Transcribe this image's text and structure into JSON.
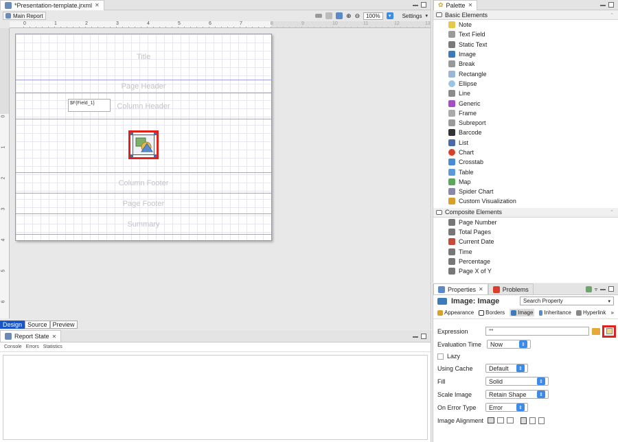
{
  "editor": {
    "tab_title": "*Presentation-template.jrxml",
    "tab_close": "✕",
    "main_report_label": "Main Report",
    "zoom_value": "100%",
    "settings_label": "Settings",
    "ruler_h_numbers": [
      "0",
      "1",
      "2",
      "3",
      "4",
      "5",
      "6",
      "7",
      "8",
      "9",
      "10",
      "11",
      "12",
      "13"
    ],
    "ruler_v_numbers": [
      "0",
      "1",
      "2",
      "3",
      "4",
      "5",
      "6"
    ],
    "bands": [
      "Title",
      "Page Header",
      "Column Header",
      "",
      "Column Footer",
      "Page Footer",
      "Summary"
    ],
    "field_label": "$F{Field_1}",
    "bottom_tabs": [
      "Design",
      "Source",
      "Preview"
    ]
  },
  "report_state": {
    "title": "Report State",
    "close": "✕",
    "subtabs": [
      "Console",
      "Errors",
      "Statistics"
    ]
  },
  "palette": {
    "title": "Palette",
    "close": "✕",
    "sections": [
      {
        "name": "Basic Elements",
        "items": [
          {
            "label": "Note",
            "icon": "note-icon",
            "color": "#e8c84a"
          },
          {
            "label": "Text Field",
            "icon": "text-field-icon",
            "color": "#9a9a9a"
          },
          {
            "label": "Static Text",
            "icon": "static-text-icon",
            "color": "#7a7a7a"
          },
          {
            "label": "Image",
            "icon": "image-icon",
            "color": "#3d7ab8"
          },
          {
            "label": "Break",
            "icon": "break-icon",
            "color": "#999999"
          },
          {
            "label": "Rectangle",
            "icon": "rectangle-icon",
            "color": "#9bb7d8"
          },
          {
            "label": "Ellipse",
            "icon": "ellipse-icon",
            "color": "#9bc3e8"
          },
          {
            "label": "Line",
            "icon": "line-icon",
            "color": "#8a8a8a"
          },
          {
            "label": "Generic",
            "icon": "generic-icon",
            "color": "#a64ec4"
          },
          {
            "label": "Frame",
            "icon": "frame-icon",
            "color": "#aaaaaa"
          },
          {
            "label": "Subreport",
            "icon": "subreport-icon",
            "color": "#9a9a9a"
          },
          {
            "label": "Barcode",
            "icon": "barcode-icon",
            "color": "#333333"
          },
          {
            "label": "List",
            "icon": "list-icon",
            "color": "#4a6aa8"
          },
          {
            "label": "Chart",
            "icon": "chart-icon",
            "color": "#d8402a"
          },
          {
            "label": "Crosstab",
            "icon": "crosstab-icon",
            "color": "#4a8ad8"
          },
          {
            "label": "Table",
            "icon": "table-icon",
            "color": "#5a9ad8"
          },
          {
            "label": "Map",
            "icon": "map-icon",
            "color": "#58a858"
          },
          {
            "label": "Spider Chart",
            "icon": "spider-chart-icon",
            "color": "#8888aa"
          },
          {
            "label": "Custom Visualization",
            "icon": "custom-visualization-icon",
            "color": "#d8a028"
          }
        ]
      },
      {
        "name": "Composite Elements",
        "items": [
          {
            "label": "Page Number",
            "icon": "page-number-icon",
            "color": "#777777"
          },
          {
            "label": "Total Pages",
            "icon": "total-pages-icon",
            "color": "#777777"
          },
          {
            "label": "Current Date",
            "icon": "current-date-icon",
            "color": "#c84a3a"
          },
          {
            "label": "Time",
            "icon": "time-icon",
            "color": "#777777"
          },
          {
            "label": "Percentage",
            "icon": "percentage-icon",
            "color": "#777777"
          },
          {
            "label": "Page X of Y",
            "icon": "page-x-of-y-icon",
            "color": "#777777"
          }
        ]
      }
    ]
  },
  "properties": {
    "title": "Properties",
    "problems_tab": "Problems",
    "element_title": "Image: Image",
    "search_placeholder": "Search Property",
    "subtabs": [
      "Appearance",
      "Borders",
      "Image",
      "Inheritance",
      "Hyperlink"
    ],
    "rows": {
      "expression_label": "Expression",
      "expression_value": "\"\"",
      "evaluation_time_label": "Evaluation Time",
      "evaluation_time_value": "Now",
      "lazy_label": "Lazy",
      "using_cache_label": "Using Cache",
      "using_cache_value": "Default",
      "fill_label": "Fill",
      "fill_value": "Solid",
      "scale_image_label": "Scale Image",
      "scale_image_value": "Retain Shape",
      "on_error_type_label": "On Error Type",
      "on_error_type_value": "Error",
      "image_alignment_label": "Image Alignment"
    },
    "highlight_color": "#e0201a"
  }
}
